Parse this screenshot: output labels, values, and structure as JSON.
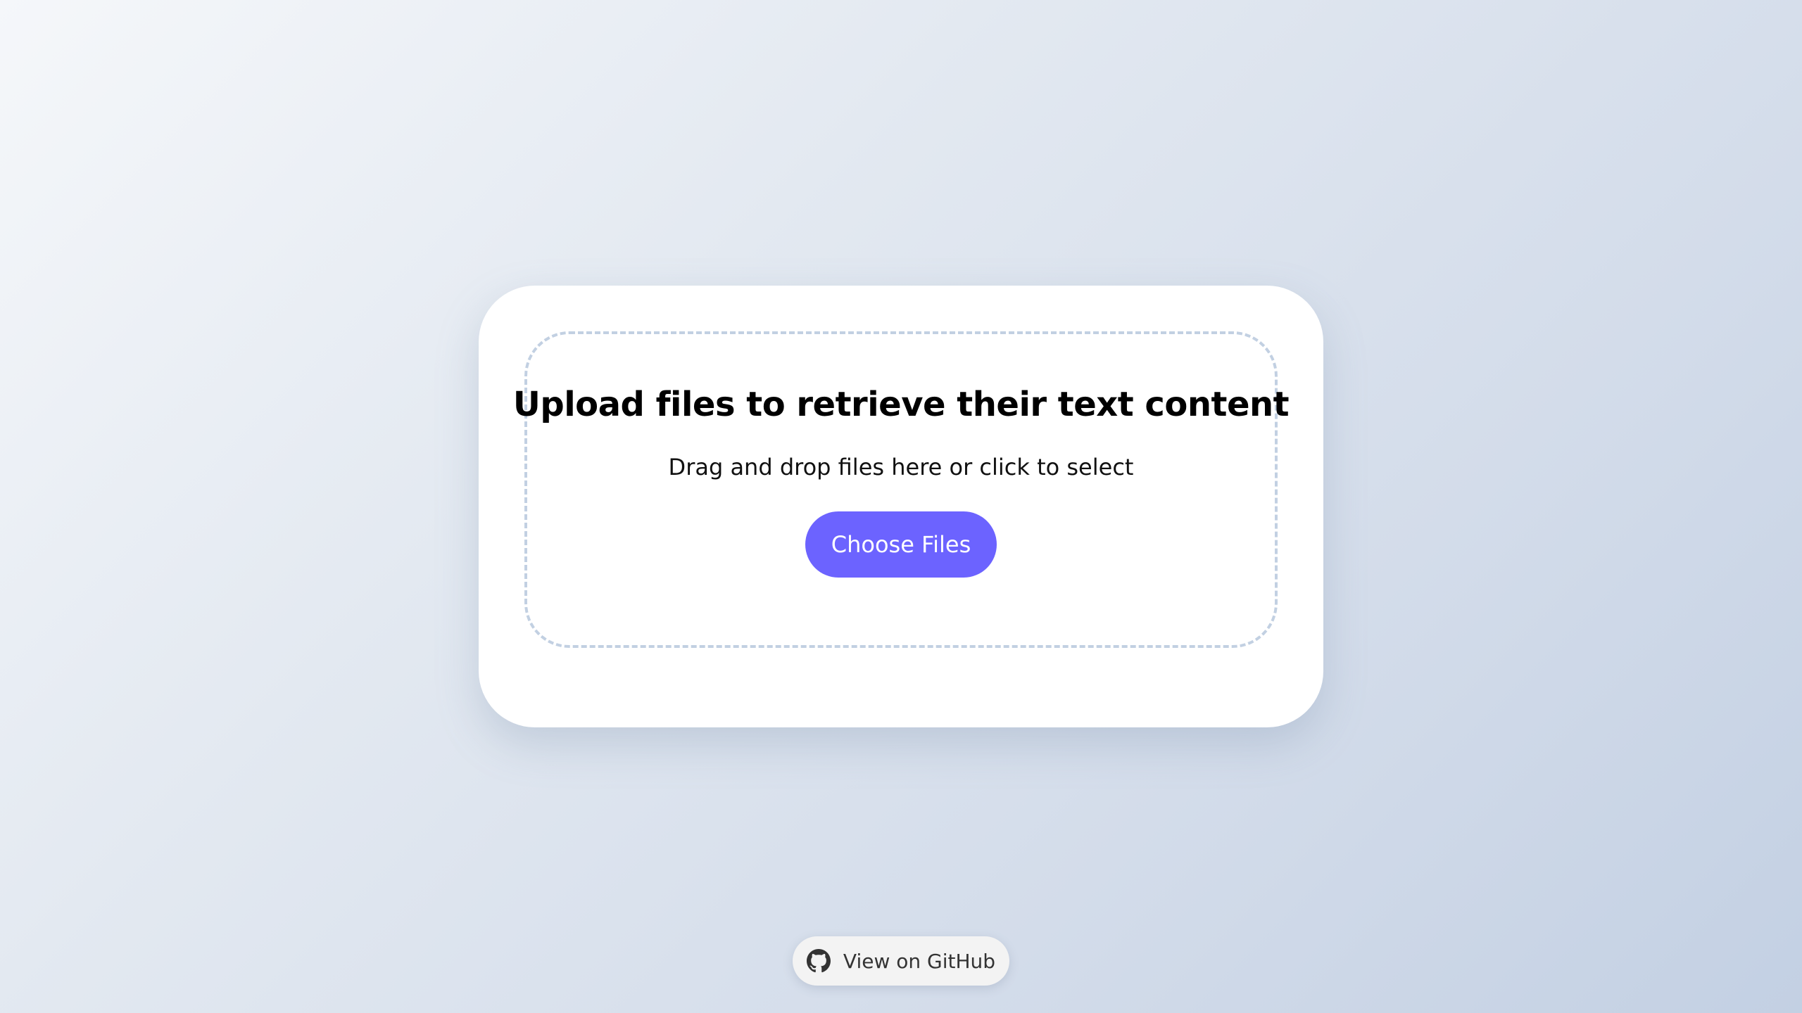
{
  "upload": {
    "title": "Upload files to retrieve their text content",
    "subtitle": "Drag and drop files here or click to select",
    "button_label": "Choose Files"
  },
  "footer": {
    "github_label": "View on GitHub",
    "github_icon": "github-icon"
  },
  "colors": {
    "accent": "#6c63ff",
    "dropzone_border": "#c2d0e2",
    "card_background": "#ffffff"
  }
}
